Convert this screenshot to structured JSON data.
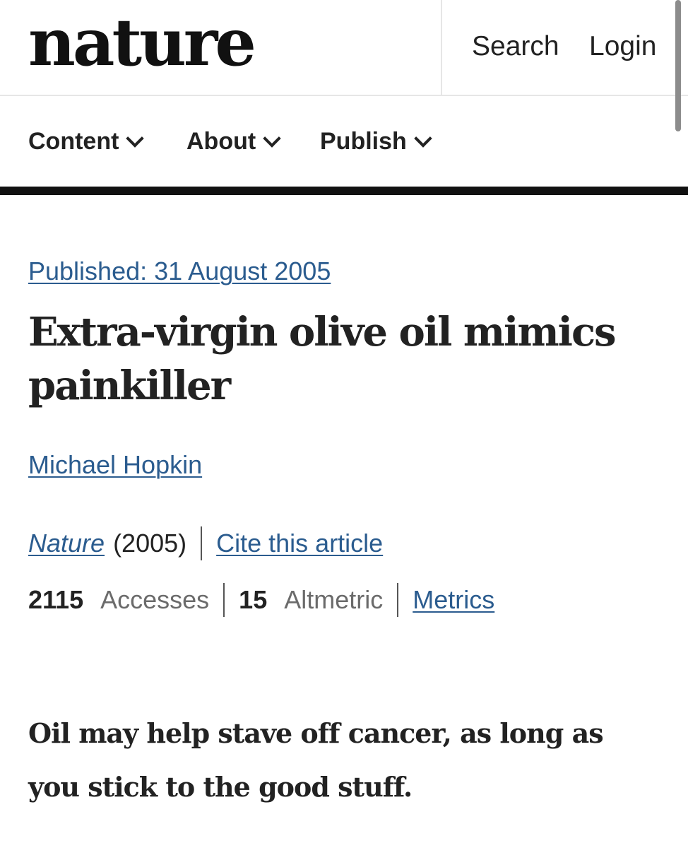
{
  "header": {
    "logo": "nature",
    "search_label": "Search",
    "login_label": "Login"
  },
  "nav": {
    "items": [
      {
        "label": "Content",
        "icon": "chevron-down-icon"
      },
      {
        "label": "About",
        "icon": "chevron-down-icon"
      },
      {
        "label": "Publish",
        "icon": "chevron-down-icon"
      }
    ]
  },
  "article": {
    "published": "Published: 31 August 2005",
    "title": "Extra-virgin olive oil mimics painkiller",
    "author": "Michael Hopkin",
    "journal": "Nature",
    "year": "(2005)",
    "cite_label": "Cite this article",
    "metrics": {
      "accesses_count": "2115",
      "accesses_label": "Accesses",
      "altmetric_count": "15",
      "altmetric_label": "Altmetric",
      "metrics_link": "Metrics"
    },
    "standfirst": "Oil may help stave off cancer, as long as you stick to the good stuff."
  },
  "colors": {
    "link": "#2b5c8f",
    "text": "#222222",
    "muted": "#6b6b6b",
    "rule": "#111111"
  }
}
